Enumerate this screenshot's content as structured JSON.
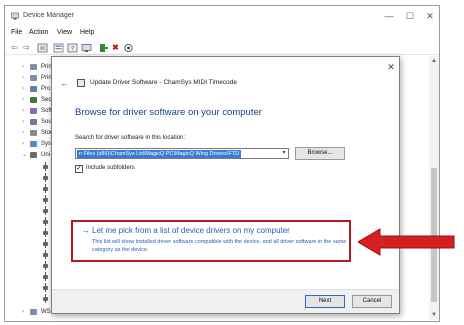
{
  "window": {
    "title": "Device Manager",
    "min_glyph": "—",
    "max_glyph": "☐",
    "close_glyph": "✕"
  },
  "menu": [
    "File",
    "Action",
    "View",
    "Help"
  ],
  "toolbar_icons": [
    "back-arrow-icon",
    "forward-arrow-icon",
    "properties-icon",
    "list-icon",
    "help-icon",
    "monitor-icon",
    "update-driver-icon",
    "uninstall-icon",
    "scan-icon"
  ],
  "tree": {
    "items": [
      {
        "label": "Prin",
        "icon": "printer-icon"
      },
      {
        "label": "Prin",
        "icon": "printer-icon"
      },
      {
        "label": "Pro",
        "icon": "processor-icon"
      },
      {
        "label": "Sec",
        "icon": "security-icon"
      },
      {
        "label": "Soft",
        "icon": "software-icon"
      },
      {
        "label": "Sou",
        "icon": "sound-icon"
      },
      {
        "label": "Stor",
        "icon": "storage-icon"
      },
      {
        "label": "Syst",
        "icon": "system-icon"
      },
      {
        "label": "Uni",
        "icon": "usb-icon"
      }
    ],
    "last_item": {
      "label": "WS",
      "icon": "wsd-icon"
    }
  },
  "dialog": {
    "close_glyph": "✕",
    "back_glyph": "←",
    "title": "Update Driver Software - ChamSys MIDI Timecode",
    "heading": "Browse for driver software on your computer",
    "search_label": "Search for driver software in this location:",
    "path_value": "n Files (x86)\\ChamSys Ltd\\MagicQ PC\\MagicQ Wing Drivers\\FTD",
    "dropdown_glyph": "▾",
    "browse_label": "Browse...",
    "include_subfolders": {
      "label": "Include subfolders",
      "checked": true,
      "glyph": "✓"
    },
    "pick_option": {
      "arrow": "→",
      "title": "Let me pick from a list of device drivers on my computer",
      "description": "This list will show installed driver software compatible with the device, and all driver software in the same category as the device."
    },
    "next_label": "Next",
    "cancel_label": "Cancel"
  },
  "colors": {
    "highlight_border": "#b01c1c",
    "link_blue": "#2a5cb8",
    "heading_blue": "#1a3f8c",
    "arrow_red": "#d42020",
    "selection_blue": "#3a7bd5"
  }
}
